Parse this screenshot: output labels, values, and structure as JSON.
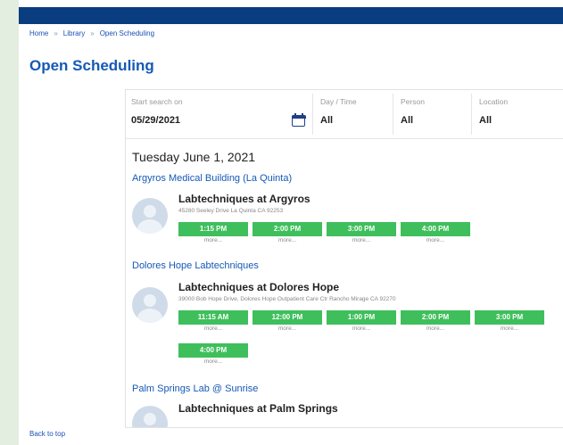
{
  "breadcrumb": {
    "items": [
      "Home",
      "Library",
      "Open Scheduling"
    ],
    "separator": "»"
  },
  "page_title": "Open Scheduling",
  "filters": {
    "start": {
      "label": "Start search on",
      "value": "05/29/2021"
    },
    "day_time": {
      "label": "Day / Time",
      "value": "All"
    },
    "person": {
      "label": "Person",
      "value": "All"
    },
    "location": {
      "label": "Location",
      "value": "All"
    }
  },
  "results": {
    "date_heading": "Tuesday June 1, 2021",
    "locations": [
      {
        "name": "Argyros Medical Building (La Quinta)",
        "provider": "Labtechniques at Argyros",
        "address": "45280 Seeley Drive La Quinta CA 92253",
        "slots": [
          "1:15 PM",
          "2:00 PM",
          "3:00 PM",
          "4:00 PM"
        ]
      },
      {
        "name": "Dolores Hope Labtechniques",
        "provider": "Labtechniques at Dolores Hope",
        "address": "39000 Bob Hope Drive, Dolores Hope Outpatient Care Ctr Rancho Mirage CA 92270",
        "slots": [
          "11:15 AM",
          "12:00 PM",
          "1:00 PM",
          "2:00 PM",
          "3:00 PM",
          "4:00 PM"
        ]
      },
      {
        "name": "Palm Springs Lab @ Sunrise",
        "provider": "Labtechniques at Palm Springs"
      }
    ],
    "more_label": "more..."
  },
  "back_to_top": "Back to top",
  "colors": {
    "header": "#0a3d80",
    "link": "#1559b6",
    "slot": "#3fbf5c",
    "sidebar": "#e4eee0"
  },
  "icons": {
    "calendar": "calendar-icon",
    "avatar": "avatar-placeholder-icon"
  }
}
